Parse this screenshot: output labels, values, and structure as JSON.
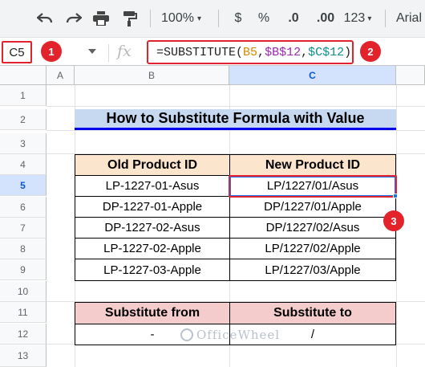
{
  "toolbar": {
    "zoom": "100%",
    "currency": "$",
    "percent": "%",
    "decrease_decimal": ".0",
    "increase_decimal": ".00",
    "number_format": "123",
    "font": "Arial"
  },
  "formula_bar": {
    "name_box": "C5",
    "fx": "fx",
    "formula_parts": [
      "=SUBSTITUTE(",
      "B5",
      ",",
      "$B$12",
      ",",
      "$C$12",
      ")"
    ]
  },
  "badges": [
    "1",
    "2",
    "3"
  ],
  "columns": [
    "A",
    "B",
    "C"
  ],
  "rows": [
    "1",
    "2",
    "3",
    "4",
    "5",
    "6",
    "7",
    "8",
    "9",
    "10",
    "11",
    "12",
    "13"
  ],
  "sheet": {
    "title": "How to Substitute Formula with Value",
    "table_headers": [
      "Old Product ID",
      "New Product ID"
    ],
    "table_rows": [
      [
        "LP-1227-01-Asus",
        "LP/1227/01/Asus"
      ],
      [
        "DP-1227-01-Apple",
        "DP/1227/01/Apple"
      ],
      [
        "DP-1227-02-Asus",
        "DP/1227/02/Asus"
      ],
      [
        "LP-1227-02-Apple",
        "LP/1227/02/Apple"
      ],
      [
        "LP-1227-03-Apple",
        "LP/1227/03/Apple"
      ]
    ],
    "sub_headers": [
      "Substitute from",
      "Substitute to"
    ],
    "sub_values": [
      "-",
      "/"
    ]
  },
  "watermark": "OfficeWheel",
  "colors": {
    "title_fill": "#c6d9f1",
    "title_underline": "#0000ee",
    "header_peach": "#fce5cd",
    "header_pink": "#f4cccc",
    "badge_red": "#e2232c",
    "selection_blue": "#1a73e8"
  }
}
